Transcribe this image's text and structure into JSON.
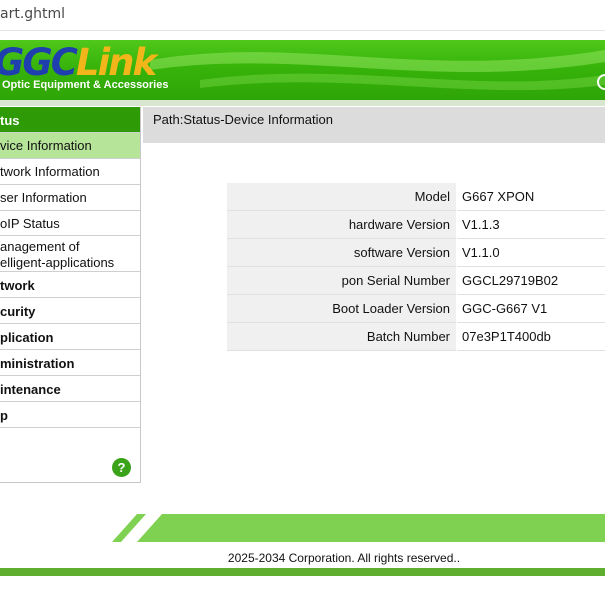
{
  "browser": {
    "address": "art.ghtml"
  },
  "header": {
    "logo_part1": "GGC",
    "logo_part2": "Link",
    "tagline": "Optic Equipment & Accessories"
  },
  "menu": {
    "section_title": "tus",
    "items": [
      {
        "label": "vice Information",
        "active": true
      },
      {
        "label": "twork Information"
      },
      {
        "label": "ser Information"
      },
      {
        "label": "oIP Status"
      },
      {
        "label": "anagement of",
        "label2": "elligent-applications"
      }
    ],
    "sections": [
      {
        "label": "twork"
      },
      {
        "label": "curity"
      },
      {
        "label": "plication"
      },
      {
        "label": "ministration"
      },
      {
        "label": "intenance"
      },
      {
        "label": "p"
      }
    ],
    "help": "?"
  },
  "main": {
    "path": "Path:Status-Device Information",
    "rows": [
      {
        "label": "Model",
        "value": "G667 XPON"
      },
      {
        "label": "hardware Version",
        "value": "V1.1.3"
      },
      {
        "label": "software Version",
        "value": "V1.1.0"
      },
      {
        "label": "pon Serial Number",
        "value": "GGCL29719B02"
      },
      {
        "label": "Boot Loader Version",
        "value": "GGC-G667 V1"
      },
      {
        "label": "Batch Number",
        "value": "07e3P1T400db"
      }
    ]
  },
  "footer": {
    "copyright": "2025-2034 Corporation. All rights reserved.."
  },
  "colors": {
    "brand_green": "#37b30a",
    "active_menu": "#b6e59a",
    "logo_blue": "#1f3fae",
    "logo_yellow": "#f2b61b"
  }
}
